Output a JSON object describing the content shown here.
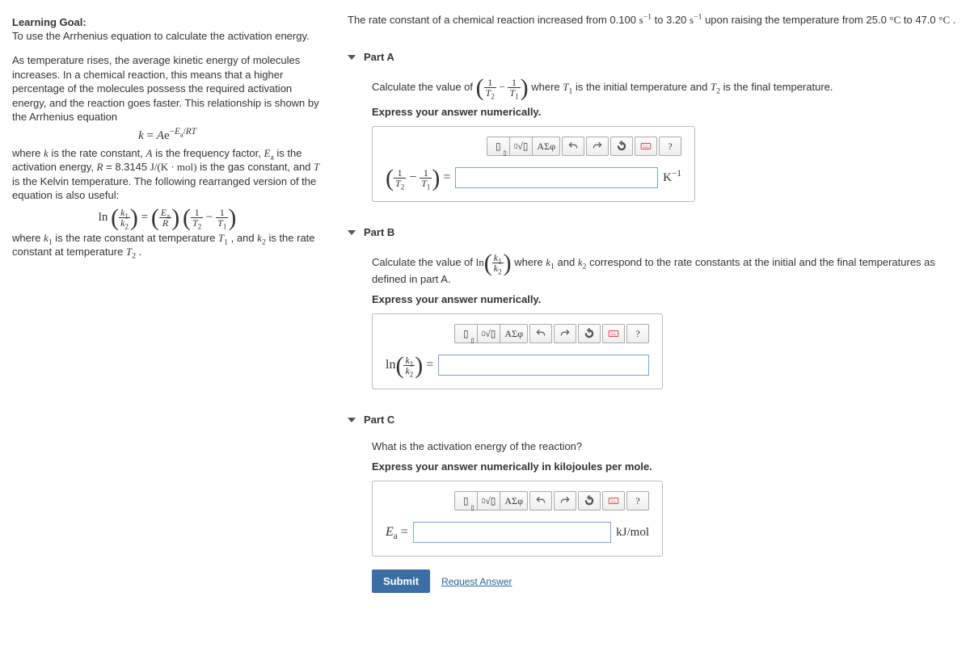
{
  "left": {
    "goal_title": "Learning Goal:",
    "goal_text": "To use the Arrhenius equation to calculate the activation energy.",
    "para1": "As temperature rises, the average kinetic energy of molecules increases. In a chemical reaction, this means that a higher percentage of the molecules possess the required activation energy, and the reaction goes faster. This relationship is shown by the Arrhenius equation",
    "eq1_html": "k = Ae<sup style='font-size:0.7em'>−E<sub>a</sub>/RT</sup>",
    "para2_html": "where <i>k</i> is the rate constant, <i>A</i> is the frequency factor, <i>E</i><sub>a</sub> is the activation energy, <i>R</i> = 8.3145 J/(K · mol) is the gas constant, and <i>T</i> is the Kelvin temperature. The following rearranged version of the equation is also useful:",
    "para3_html": "where <i>k</i><sub>1</sub> is the rate constant at temperature <i>T</i><sub>1</sub> , and <i>k</i><sub>2</sub> is the rate constant at temperature <i>T</i><sub>2</sub> ."
  },
  "problem_html": "The rate constant of a chemical reaction increased from 0.100 s<sup>−1</sup> to 3.20 s<sup>−1</sup> upon raising the temperature from 25.0 °C to 47.0 °C .",
  "partA": {
    "title": "Part A",
    "prompt_pre": "Calculate the value of ",
    "prompt_post_html": " where <i>T</i><sub>1</sub> is the initial temperature and <i>T</i><sub>2</sub> is the final temperature.",
    "express": "Express your answer numerically.",
    "unit_html": "K<sup>−1</sup>"
  },
  "partB": {
    "title": "Part B",
    "prompt_pre": "Calculate the value of ",
    "prompt_post_html": " where <i>k</i><sub>1</sub> and <i>k</i><sub>2</sub> correspond to the rate constants at the initial and the final temperatures as defined in part A.",
    "express": "Express your answer numerically."
  },
  "partC": {
    "title": "Part C",
    "prompt": "What is the activation energy of the reaction?",
    "express": "Express your answer numerically in kilojoules per mole.",
    "var_html": "E<sub style='font-size:0.7em'>a</sub> =",
    "unit": "kJ/mol"
  },
  "toolbar": {
    "templates": "▭",
    "sqrt": "√▭",
    "greek": "ΑΣφ",
    "undo": "↶",
    "redo": "↷",
    "reset": "↻",
    "keyboard": "⌨",
    "help": "?"
  },
  "submit": "Submit",
  "request": "Request Answer"
}
